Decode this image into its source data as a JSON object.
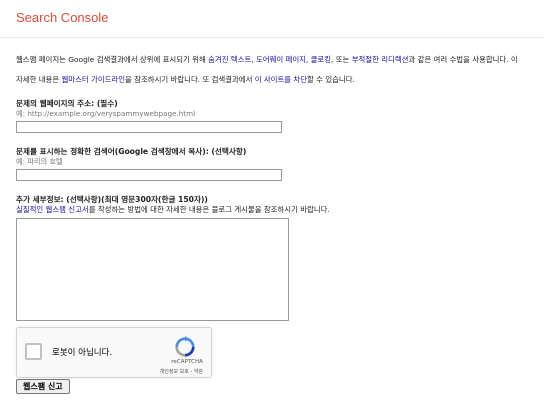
{
  "header": {
    "brand": "Search Console"
  },
  "intro": {
    "p1": [
      "웹스팸 페이지는 Google 검색결과에서 상위에 표시되기 위해 ",
      "숨겨진 텍스트",
      ", ",
      "도어웨이 페이지",
      ", ",
      "클로킹",
      ", 또는 ",
      "부적절한 리디렉션",
      "과 같은 여러 수법을 사용합니다. 이"
    ],
    "p2": [
      "자세한 내용은 ",
      "웹마스터 가이드라인",
      "을 참조하시기 바랍니다. 또 검색결과에서 ",
      "이 사이트를 차단",
      "할 수 있습니다."
    ]
  },
  "form": {
    "url": {
      "label": "문제의 웹페이지의 주소: (필수)",
      "hint": "예: http://example.org/veryspammywebpage.html",
      "value": ""
    },
    "query": {
      "label": "문제를 표시하는 정확한 검색어(Google 검색창에서 복사): (선택사항)",
      "hint": "예: 파리의 호텔",
      "value": ""
    },
    "details": {
      "label": "추가 세부정보: (선택사항)(최대 영문300자(한글 150자))",
      "hint_link": "실질적인 웹스팸 신고서",
      "hint_rest": "를 작성하는 방법에 대한 자세한 내용은 블로그 게시물을 참조하시기 바랍니다.",
      "value": ""
    }
  },
  "captcha": {
    "label": "로봇이 아닙니다.",
    "brand": "reCAPTCHA",
    "terms": "개인정보 보호 - 약관"
  },
  "submit_label": "웹스팸 신고",
  "colors": {
    "brand": "#dd4b39",
    "link": "#1a0dab"
  }
}
